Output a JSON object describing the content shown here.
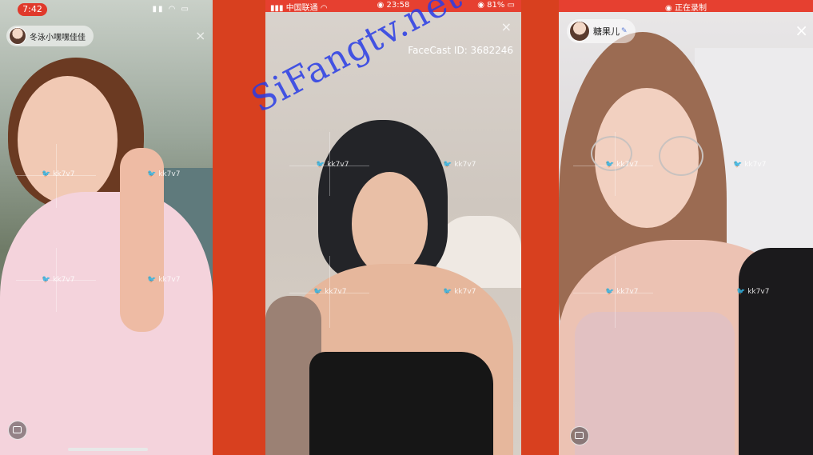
{
  "panel1": {
    "time": "7:42",
    "host_name": "冬泳小嘿嘿佳佳",
    "close": "×"
  },
  "panel2": {
    "carrier": "中国联通",
    "time": "23:58",
    "battery": "81%",
    "close": "×",
    "facecast_id": "FaceCast ID: 3682246"
  },
  "panel3": {
    "recording": "正在录制",
    "host_name": "糖果儿",
    "close": "×"
  },
  "watermark_text": "kk7v7",
  "site_watermark": "SiFangtv.net",
  "colors": {
    "background_red": "#d8401f",
    "status_red": "#e64030",
    "site_watermark_blue": "#2a3ce6"
  }
}
